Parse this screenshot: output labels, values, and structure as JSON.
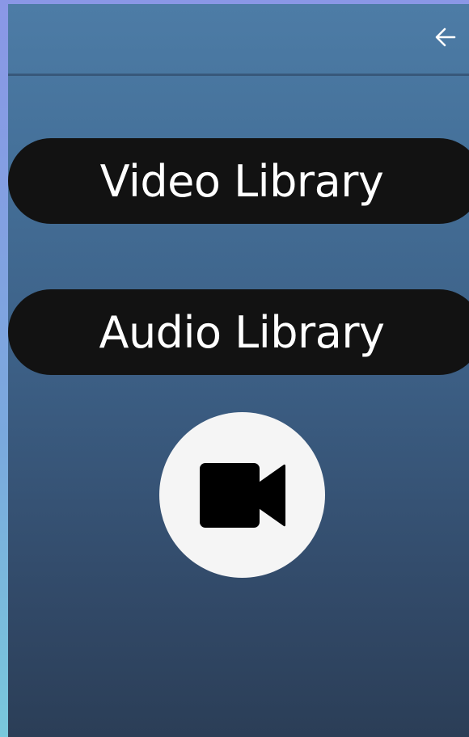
{
  "header": {
    "back_icon": "arrow-left-icon"
  },
  "library": {
    "video_label": "Video Library",
    "audio_label": "Audio Library"
  },
  "record": {
    "icon": "video-camera-icon"
  },
  "colors": {
    "button_bg": "#121212",
    "button_text": "#ffffff",
    "record_bg": "#f5f5f5",
    "screen_top": "#4d7ca6",
    "screen_bottom": "#2b3e57"
  }
}
